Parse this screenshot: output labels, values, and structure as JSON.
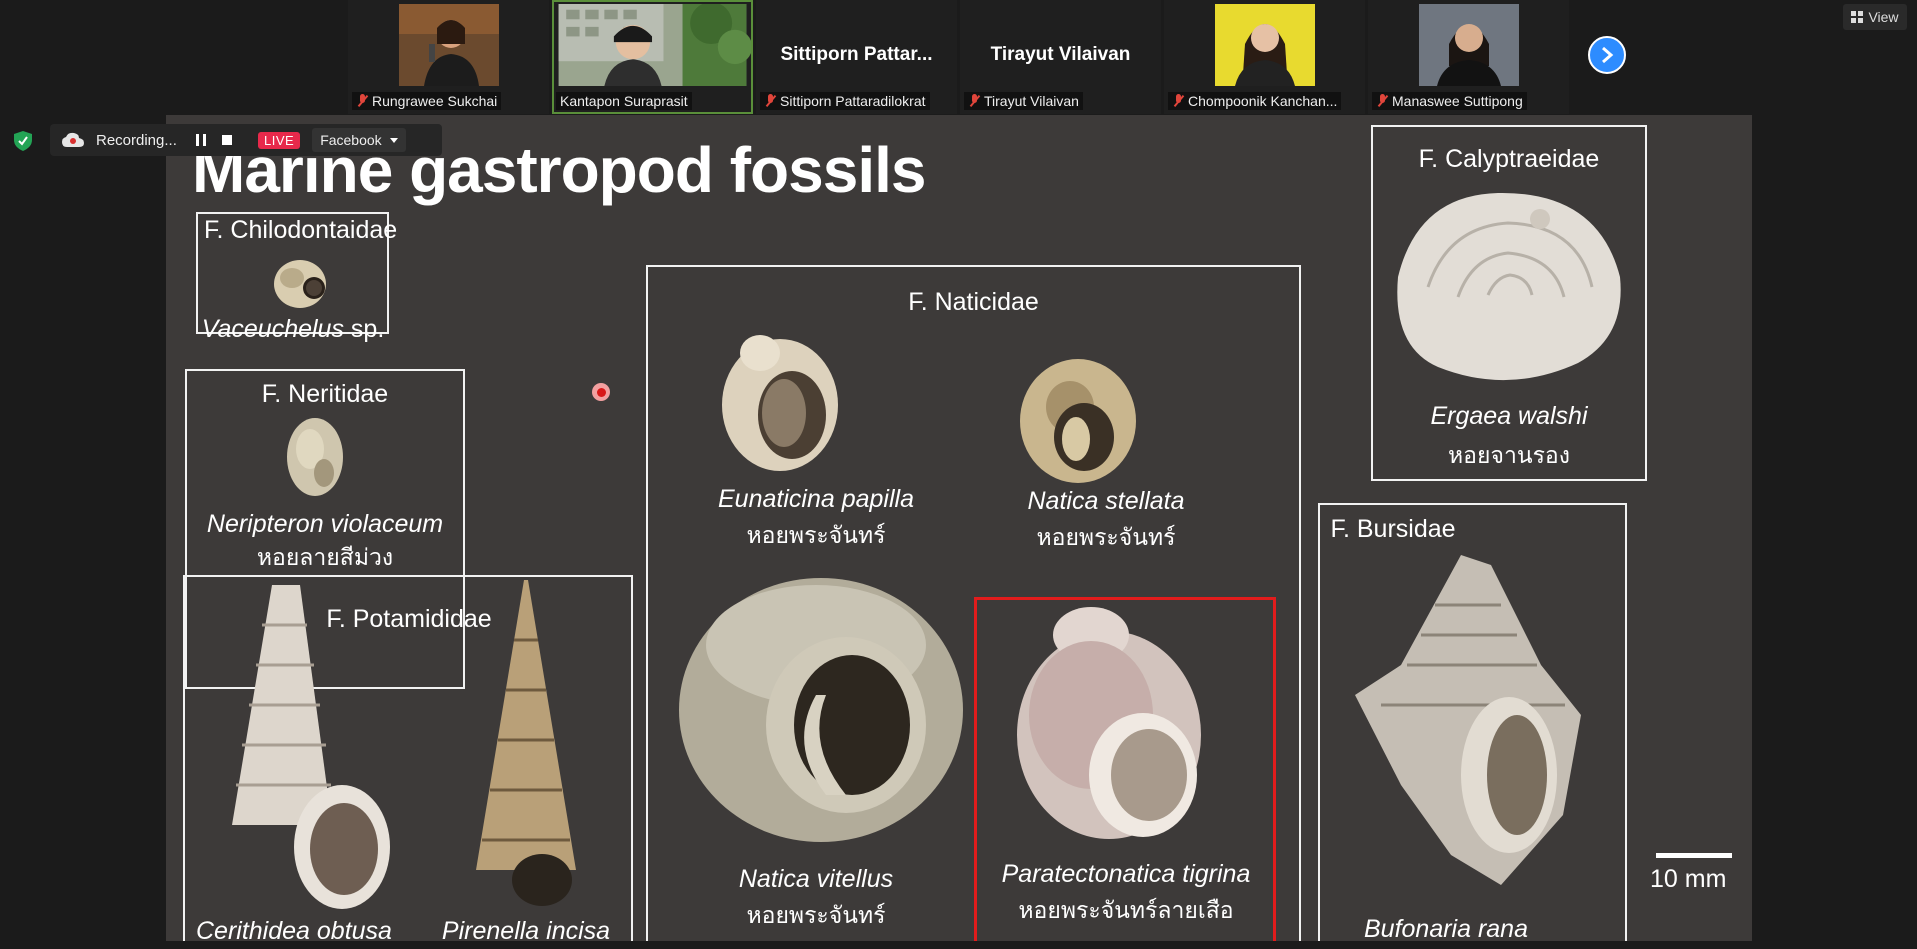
{
  "participants": [
    {
      "name": "Rungrawee Sukchai",
      "muted": true,
      "video": true
    },
    {
      "name": "Kantapon Suraprasit",
      "muted": false,
      "video": true,
      "active": true
    },
    {
      "name": "Sittiporn Pattaradilokrat",
      "display_name": "Sittiporn  Pattar...",
      "muted": true,
      "video": false
    },
    {
      "name": "Tirayut Vilaivan",
      "display_name": "Tirayut Vilaivan",
      "muted": true,
      "video": false
    },
    {
      "name": "Chompoonik Kanchan...",
      "muted": true,
      "video": true
    },
    {
      "name": "Manaswee Suttipong",
      "muted": true,
      "video": true
    }
  ],
  "top_controls": {
    "next_icon": "chevron-right-icon",
    "view_label": "View"
  },
  "status_bar": {
    "recording_label": "Recording...",
    "live_label": "LIVE",
    "stream_target": "Facebook"
  },
  "slide": {
    "title": "Marine gastropod fossils",
    "families": [
      {
        "family": "F. Chilodontaidae",
        "species": [
          {
            "name": "Vaceuchelus",
            "suffix": " sp."
          }
        ]
      },
      {
        "family": "F. Neritidae",
        "species": [
          {
            "name": "Neripteron violaceum",
            "thai": "หอยลายสีม่วง"
          }
        ]
      },
      {
        "family": "F. Potamididae",
        "species": [
          {
            "name": "Cerithidea obtusa"
          },
          {
            "name": "Pirenella incisa"
          }
        ]
      },
      {
        "family": "F. Naticidae",
        "species": [
          {
            "name": "Eunaticina papilla",
            "thai": "หอยพระจันทร์"
          },
          {
            "name": "Natica stellata",
            "thai": "หอยพระจันทร์"
          },
          {
            "name": "Natica vitellus",
            "thai": "หอยพระจันทร์"
          },
          {
            "name": "Paratectonatica tigrina",
            "thai": "หอยพระจันทร์ลายเสือ",
            "highlighted": true
          }
        ]
      },
      {
        "family": "F. Calyptraeidae",
        "species": [
          {
            "name": "Ergaea walshi",
            "thai": "หอยจานรอง"
          }
        ]
      },
      {
        "family": "F. Bursidae",
        "species": [
          {
            "name": "Bufonaria rana"
          }
        ]
      }
    ],
    "scale_label": "10 mm"
  },
  "colors": {
    "live": "#e8294b",
    "highlight": "#e21c1c",
    "next_button": "#2d8cff",
    "slide_bg": "#3d3a39"
  }
}
